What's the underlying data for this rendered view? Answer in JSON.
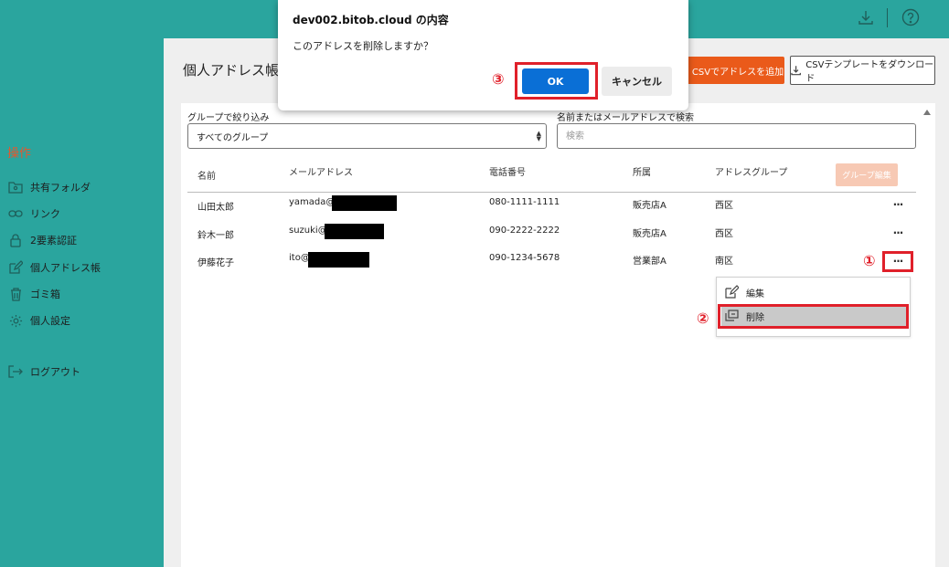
{
  "sidebar": {
    "heading": "操作",
    "items": [
      {
        "label": "共有フォルダ",
        "icon": "folder-icon"
      },
      {
        "label": "リンク",
        "icon": "link-icon"
      },
      {
        "label": "2要素認証",
        "icon": "lock-icon"
      },
      {
        "label": "個人アドレス帳",
        "icon": "edit-icon"
      },
      {
        "label": "ゴミ箱",
        "icon": "trash-icon"
      },
      {
        "label": "個人設定",
        "icon": "gear-icon"
      },
      {
        "label": "ログアウト",
        "icon": "logout-icon"
      }
    ]
  },
  "topbar": {
    "download_icon": "download-icon",
    "help_icon": "help-icon"
  },
  "page": {
    "title": "個人アドレス帳",
    "csv_add_label": "CSVでアドレスを追加",
    "csv_template_label": "CSVテンプレートをダウンロード"
  },
  "filter": {
    "group_label": "グループで絞り込み",
    "group_selected": "すべてのグループ",
    "search_label": "名前またはメールアドレスで検索",
    "search_placeholder": "検索"
  },
  "table": {
    "headers": [
      "名前",
      "メールアドレス",
      "電話番号",
      "所属",
      "アドレスグループ"
    ],
    "group_edit_label": "グループ編集",
    "rows": [
      {
        "name": "山田太郎",
        "email": "yamada@",
        "phone": "080-1111-1111",
        "dept": "販売店A",
        "group": "西区"
      },
      {
        "name": "鈴木一郎",
        "email": "suzuki@",
        "phone": "090-2222-2222",
        "dept": "販売店A",
        "group": "西区"
      },
      {
        "name": "伊藤花子",
        "email": "ito@",
        "phone": "090-1234-5678",
        "dept": "営業部A",
        "group": "南区"
      }
    ]
  },
  "context_menu": {
    "edit_label": "編集",
    "delete_label": "削除"
  },
  "steps": {
    "one": "①",
    "two": "②",
    "three": "③"
  },
  "dialog": {
    "title": "dev002.bitob.cloud の内容",
    "message": "このアドレスを削除しますか？",
    "ok_label": "OK",
    "cancel_label": "キャンセル"
  },
  "colors": {
    "teal": "#2aa59e",
    "orange": "#ea5a1a",
    "highlight_red": "#e0202a",
    "ok_blue": "#0a6fd6"
  }
}
